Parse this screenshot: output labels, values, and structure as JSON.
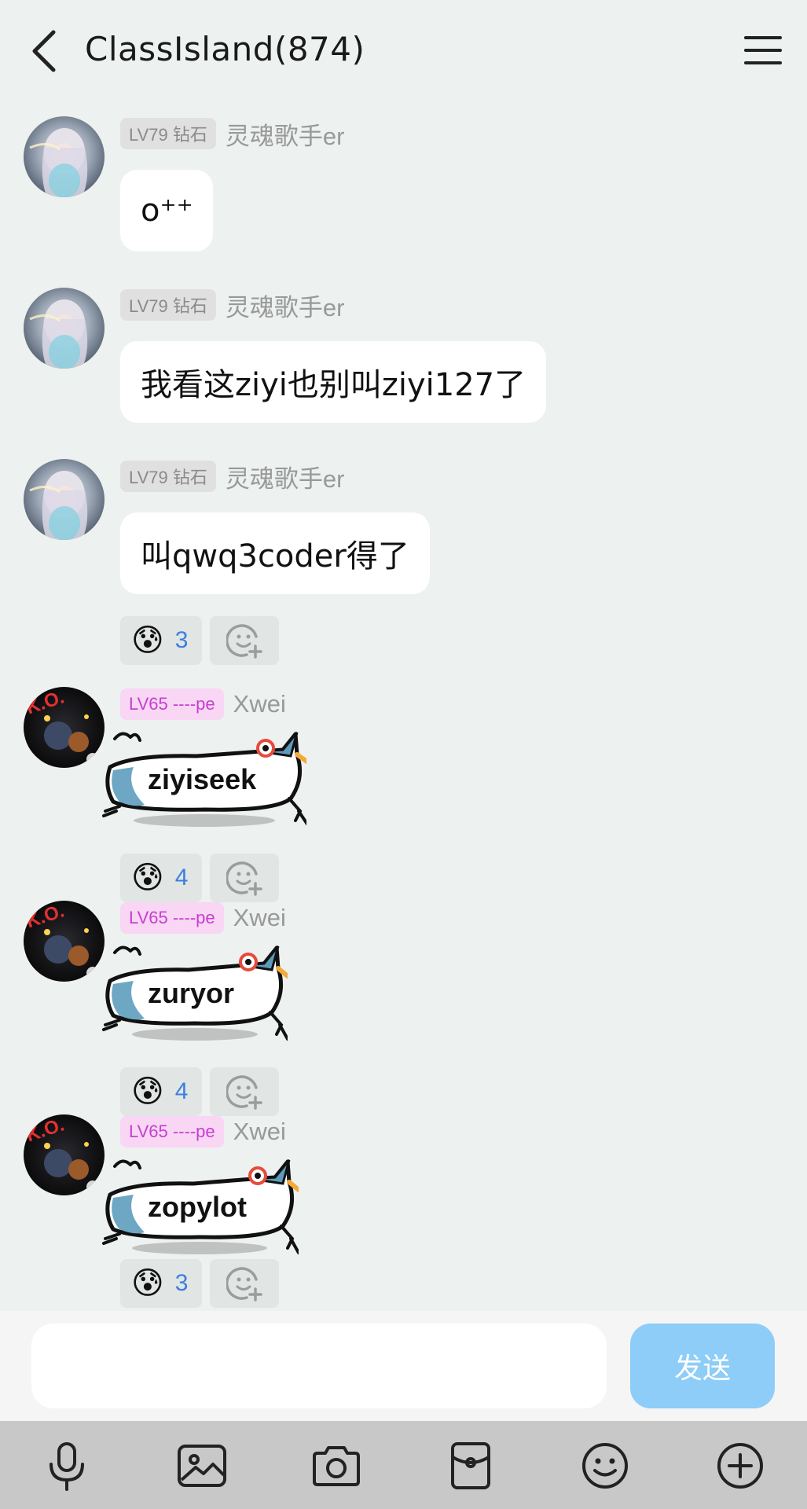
{
  "header": {
    "title": "ClassIsland(874)",
    "back_icon": "chevron-left-icon",
    "menu_icon": "hamburger-menu-icon"
  },
  "messages": [
    {
      "user": "灵魂歌手er",
      "badge": "LV79 钻石",
      "text": "o⁺⁺"
    },
    {
      "user": "灵魂歌手er",
      "badge": "LV79 钻石",
      "text": "我看这ziyi也别叫ziyi127了"
    },
    {
      "user": "灵魂歌手er",
      "badge": "LV79 钻石",
      "text": "叫qwq3coder得了",
      "reaction": {
        "emoji": "😰",
        "count": "3"
      }
    },
    {
      "user": "Xwei",
      "badge": "LV65 ----pe",
      "sticker_text": "ziyiseek",
      "reaction": {
        "emoji": "😰",
        "count": "4"
      }
    },
    {
      "user": "Xwei",
      "badge": "LV65 ----pe",
      "sticker_text": "zuryor",
      "reaction": {
        "emoji": "😰",
        "count": "4"
      }
    },
    {
      "user": "Xwei",
      "badge": "LV65 ----pe",
      "sticker_text": "zopylot",
      "reaction": {
        "emoji": "😰",
        "count": "3"
      }
    }
  ],
  "input": {
    "placeholder": "",
    "send_label": "发送"
  },
  "toolbar": {
    "icons": [
      "microphone-icon",
      "image-icon",
      "camera-icon",
      "red-packet-icon",
      "emoji-icon",
      "plus-icon"
    ]
  },
  "colors": {
    "background": "#EDF1EF",
    "send_button": "#8DCDF7",
    "reaction_count": "#3B7FE0",
    "level_badge_pink": "#C63FD0"
  }
}
